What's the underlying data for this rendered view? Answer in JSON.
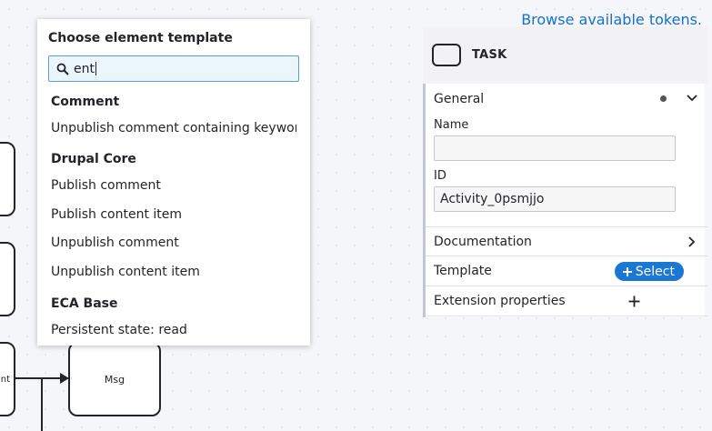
{
  "canvas": {
    "msg_label": "Msg",
    "left_fragment_label": "nt"
  },
  "browse_link": "Browse available tokens.",
  "template_picker": {
    "title": "Choose element template",
    "search_value": "ent",
    "groups": [
      {
        "heading": "Comment",
        "entries": [
          "Unpublish comment containing keywor..."
        ]
      },
      {
        "heading": "Drupal Core",
        "entries": [
          "Publish comment",
          "Publish content item",
          "Unpublish comment",
          "Unpublish content item"
        ]
      },
      {
        "heading": "ECA Base",
        "entries": [
          "Persistent state: read"
        ]
      }
    ]
  },
  "properties_panel": {
    "element_type": "TASK",
    "sections": {
      "general": "General",
      "documentation": "Documentation",
      "template": "Template",
      "extension_properties": "Extension properties"
    },
    "fields": {
      "name_label": "Name",
      "name_value": "",
      "id_label": "ID",
      "id_value": "Activity_0psmjjo"
    },
    "select_button": "Select"
  },
  "colors": {
    "accent": "#1a78d4",
    "link": "#1470d1",
    "search_bg": "#ebf5fc"
  }
}
